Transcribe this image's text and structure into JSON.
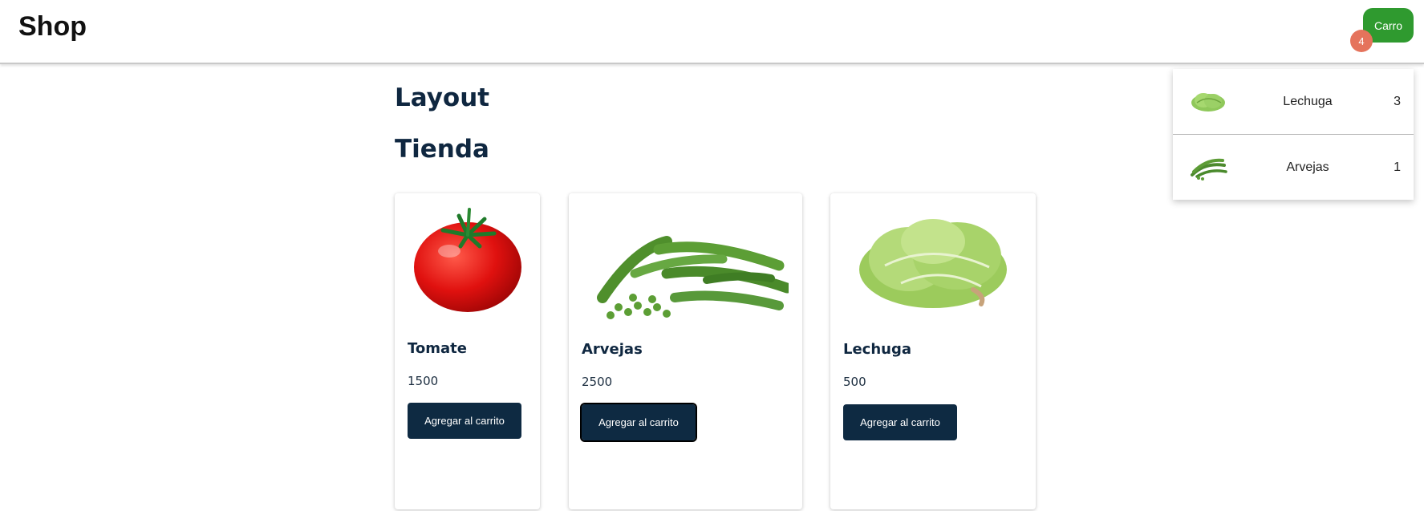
{
  "navbar": {
    "brand": "Shop",
    "cart_button": "Carro",
    "cart_count": "4"
  },
  "cart_dropdown": {
    "items": [
      {
        "name": "Lechuga",
        "qty": "3",
        "icon": "lettuce-thumbnail"
      },
      {
        "name": "Arvejas",
        "qty": "1",
        "icon": "peas-thumbnail"
      }
    ]
  },
  "main": {
    "heading": "Layout",
    "subheading": "Tienda",
    "products": [
      {
        "name": "Tomate",
        "price": "1500",
        "button": "Agregar al carrito",
        "image": "tomato-image"
      },
      {
        "name": "Arvejas",
        "price": "2500",
        "button": "Agregar al carrito",
        "image": "peas-image"
      },
      {
        "name": "Lechuga",
        "price": "500",
        "button": "Agregar al carrito",
        "image": "lettuce-image"
      }
    ]
  },
  "colors": {
    "cart_button": "#2f9a2f",
    "cart_badge": "#e5735c",
    "primary_button": "#0e2a42",
    "heading": "#0f2740"
  }
}
